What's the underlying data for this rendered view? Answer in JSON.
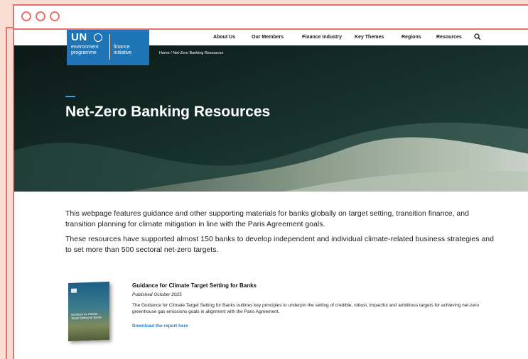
{
  "colors": {
    "frame": "#e8736a",
    "background": "#f7ddd2",
    "brand_blue": "#1f74b6",
    "link_blue": "#2a7fc1"
  },
  "logo": {
    "un": "UN",
    "environment": "environment programme",
    "finance": "finance initiative"
  },
  "nav": {
    "items": [
      "About Us",
      "Our Members",
      "Finance Industry",
      "Key Themes",
      "Regions",
      "Resources"
    ],
    "search_icon": "search-icon"
  },
  "hero": {
    "breadcrumb": "Home / Net-Zero Banking Resources",
    "title": "Net-Zero Banking Resources"
  },
  "intro": {
    "paragraph1": "This webpage features guidance and other supporting materials for banks globally on target setting, transition finance, and transition planning for climate mitigation in line with the Paris Agreement goals.",
    "paragraph2": "These resources have supported almost 150 banks to develop independent and individual climate-related business strategies and to set more than 500 sectoral net-zero targets."
  },
  "resource": {
    "cover_title": "Guidance for Climate Target Setting for Banks",
    "title": "Guidance for Climate Target Setting for Banks",
    "date": "Published October 2025",
    "description": "The Guidance for Climate Target Setting for Banks outlines key principles to underpin the setting of credible, robust, impactful and ambitious targets for achieving net-zero greenhouse gas emissions goals in alignment with the Paris Agreement.",
    "link": "Download the report here"
  }
}
